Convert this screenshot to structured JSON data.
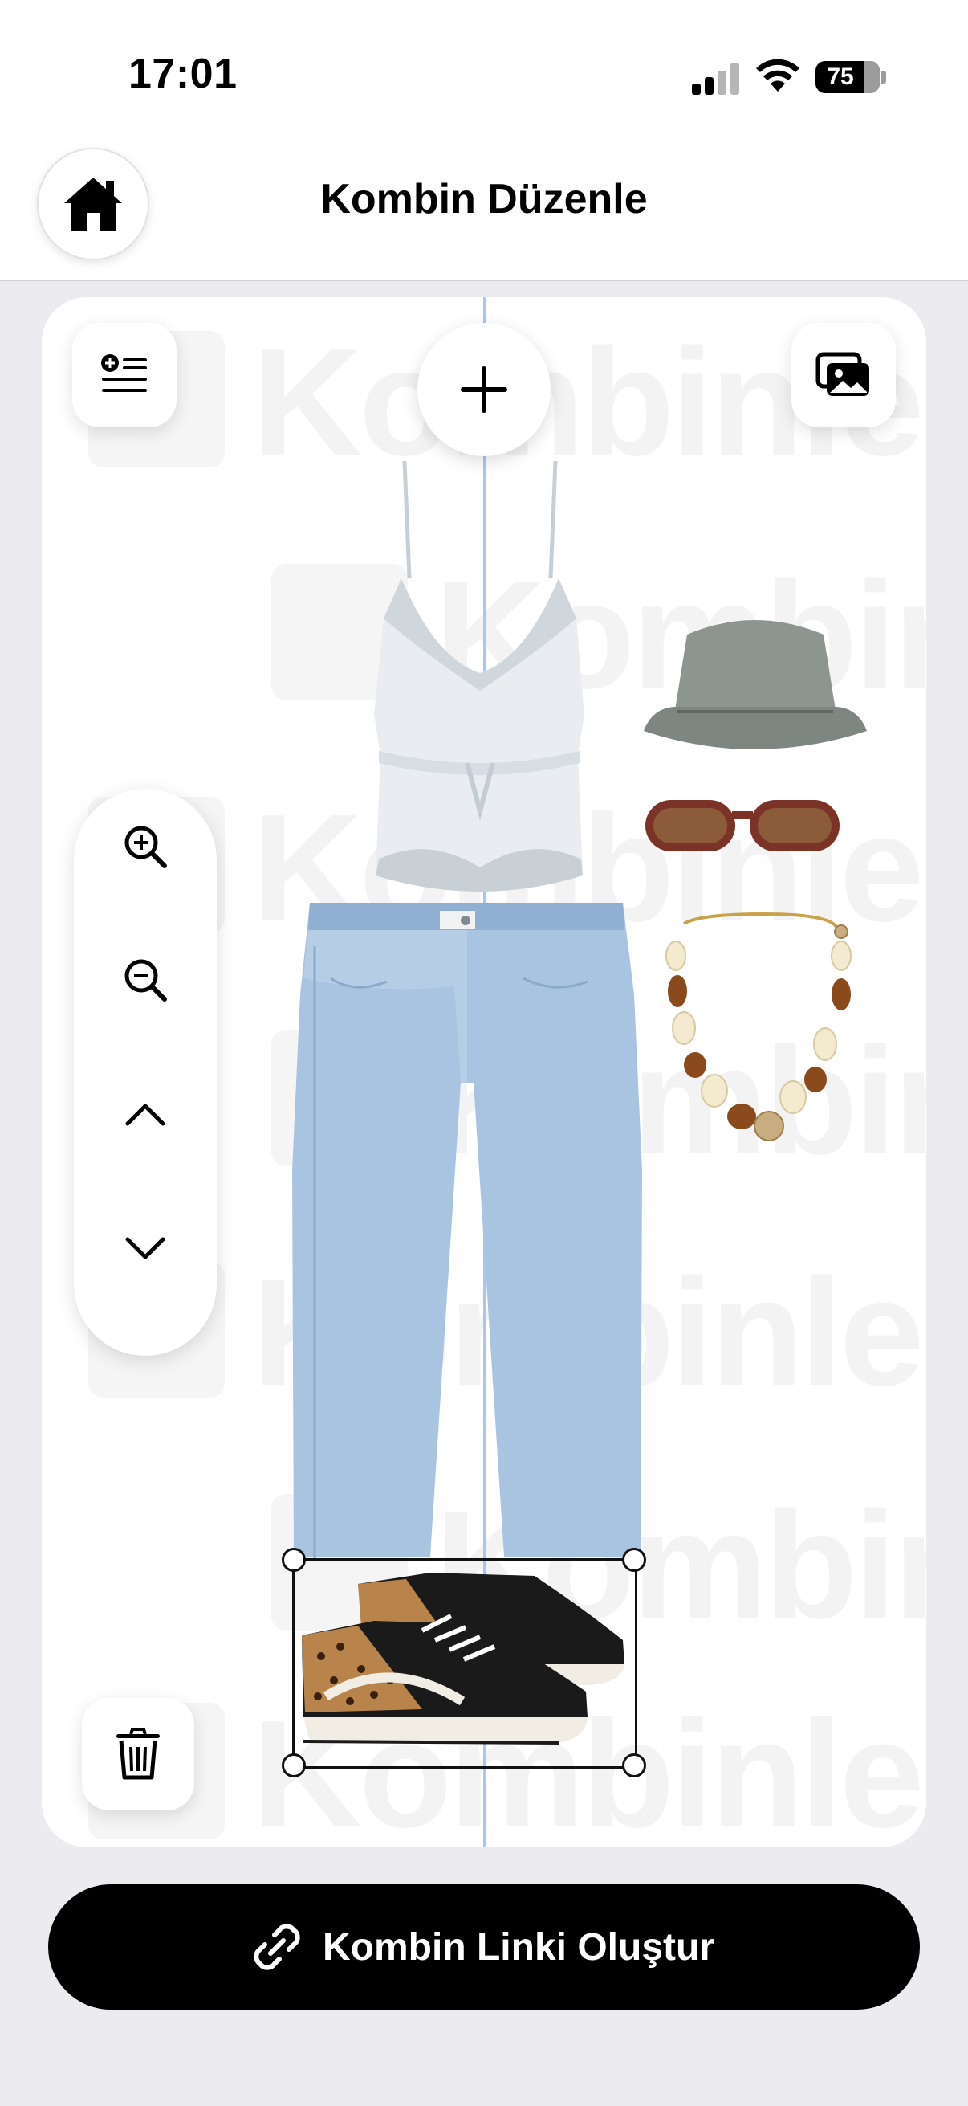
{
  "status_bar": {
    "time": "17:01",
    "battery": "75"
  },
  "header": {
    "title": "Kombin Düzenle",
    "home_icon": "house-icon"
  },
  "canvas": {
    "watermark_text": "Kombinle",
    "toolbar": {
      "add_list_icon": "list-add-icon",
      "add_icon": "plus-icon",
      "gallery_icon": "photos-icon",
      "delete_icon": "trash-icon"
    },
    "zoom_controls": [
      {
        "icon": "zoom-in-icon"
      },
      {
        "icon": "zoom-out-icon"
      },
      {
        "icon": "chevron-up-icon"
      },
      {
        "icon": "chevron-down-icon"
      }
    ],
    "items": [
      {
        "name": "lace-camisole-top"
      },
      {
        "name": "blue-jeans"
      },
      {
        "name": "leopard-sneakers",
        "selected": true
      },
      {
        "name": "bucket-hat"
      },
      {
        "name": "sunglasses"
      },
      {
        "name": "beaded-necklace"
      }
    ]
  },
  "footer": {
    "cta_label": "Kombin Linki Oluştur",
    "cta_icon": "link-icon"
  },
  "colors": {
    "accent": "#000000",
    "guide_line": "#a9c7ee",
    "background": "#ebebf0"
  }
}
